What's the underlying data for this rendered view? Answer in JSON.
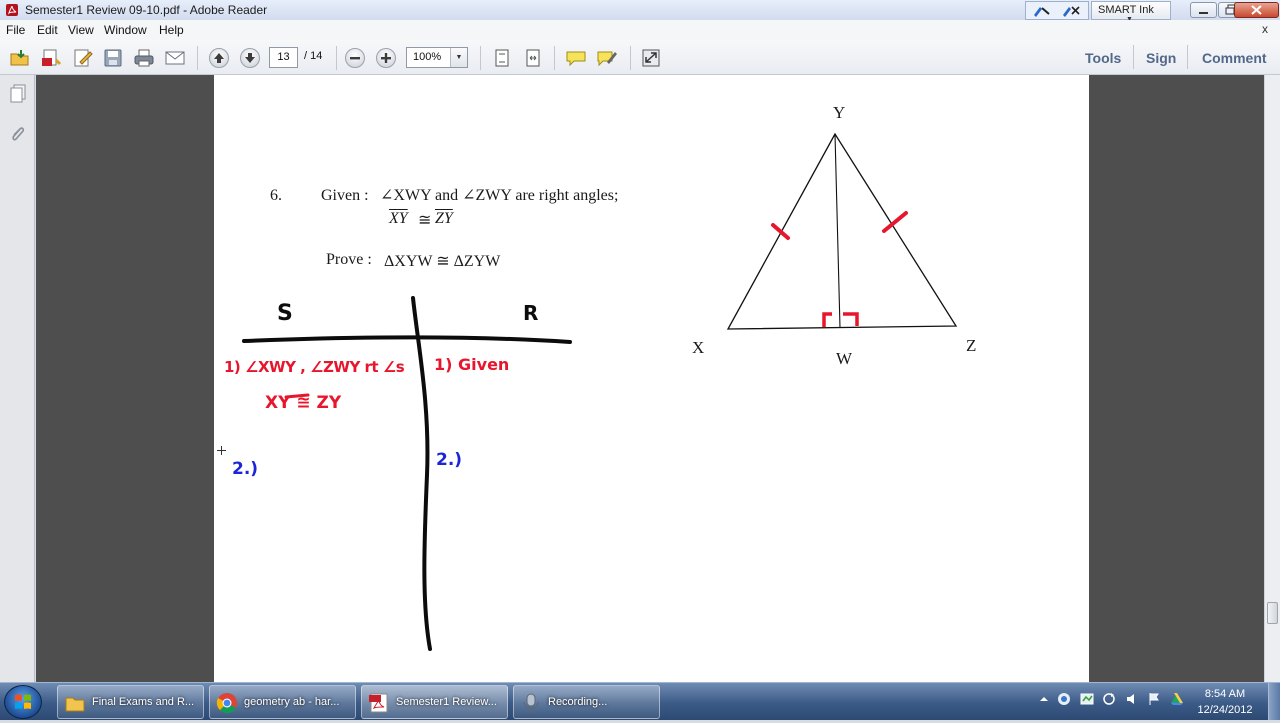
{
  "window": {
    "title": "Semester1 Review 09-10.pdf - Adobe Reader",
    "smart_ink_label": "SMART Ink"
  },
  "menu": {
    "items": [
      "File",
      "Edit",
      "View",
      "Window",
      "Help"
    ],
    "close_glyph": "x"
  },
  "toolbar": {
    "current_page": "13",
    "page_total": "/ 14",
    "zoom": "100%",
    "right_links": [
      "Tools",
      "Sign",
      "Comment"
    ],
    "icons": [
      "open-icon",
      "create-pdf-icon",
      "edit-icon",
      "save-icon",
      "print-icon",
      "email-icon",
      "page-up-icon",
      "page-down-icon",
      "zoom-out-icon",
      "zoom-in-icon",
      "fit-page-icon",
      "fit-width-icon",
      "comment-icon",
      "highlight-icon",
      "full-screen-icon"
    ]
  },
  "document": {
    "problem_number": "6.",
    "given_label": "Given :",
    "given_line1": "∠XWY and ∠ZWY are right angles;",
    "given_xy": "XY",
    "given_congruent": "≅",
    "given_zy": "ZY",
    "prove_label": "Prove :",
    "prove_text": "ΔXYW ≅ ΔZYW",
    "vertex_y": "Y",
    "vertex_x": "X",
    "vertex_w": "W",
    "vertex_z": "Z"
  },
  "annotations": {
    "column_s": "S",
    "column_r": "R",
    "step1_statement_a": "1) ∠XWY , ∠ZWY rt ∠s",
    "step1_statement_b": "XY ≅ ZY",
    "step1_reason": "1) Given",
    "step2_statement": "2.)",
    "step2_reason": "2.)",
    "colors": {
      "red": "#e8162d",
      "blue": "#1c25d8",
      "black": "#0c0c0c"
    }
  },
  "taskbar": {
    "items": [
      {
        "label": "Final Exams and R...",
        "icon": "folder-icon"
      },
      {
        "label": "geometry ab - har...",
        "icon": "chrome-icon"
      },
      {
        "label": "Semester1 Review...",
        "icon": "pdf-icon"
      },
      {
        "label": "Recording...",
        "icon": "recorder-icon"
      }
    ],
    "clock_time": "8:54 AM",
    "clock_date": "12/24/2012",
    "tray_icons": [
      "show-hidden-icon",
      "network-icon",
      "smart-board-icon",
      "volume-icon",
      "sync-icon",
      "flag-icon",
      "drive-icon"
    ]
  }
}
